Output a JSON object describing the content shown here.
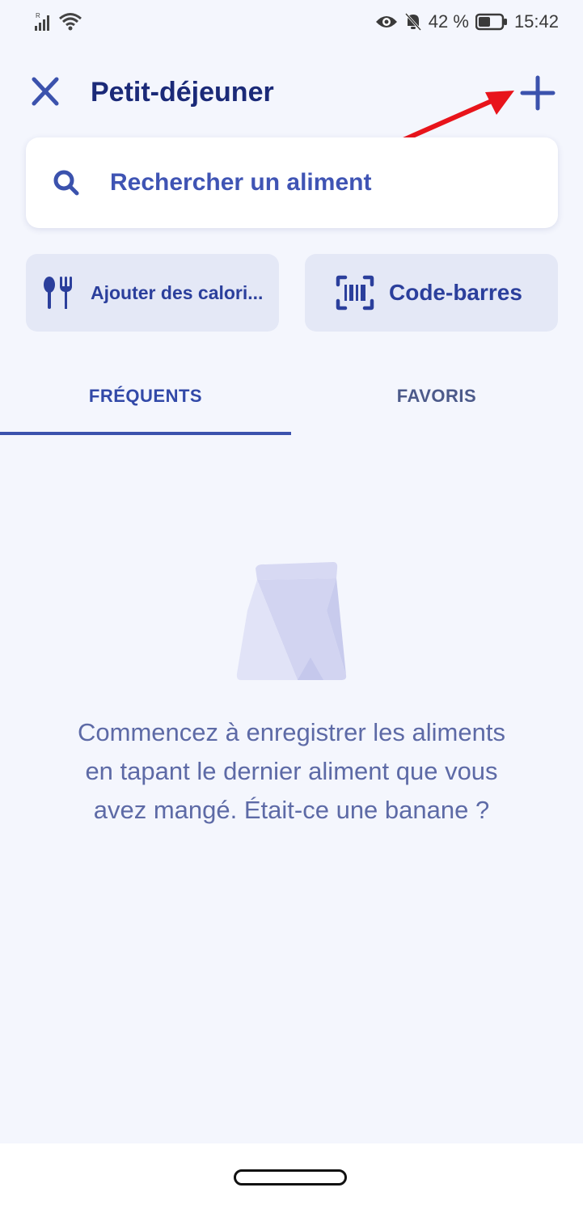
{
  "status_bar": {
    "battery_percent": "42 %",
    "time": "15:42",
    "icons": [
      "signal-icon",
      "wifi-icon",
      "eye-icon",
      "bell-off-icon",
      "battery-icon"
    ]
  },
  "header": {
    "title": "Petit-déjeuner",
    "close_icon": "close-icon",
    "add_icon": "plus-icon"
  },
  "search": {
    "placeholder": "Rechercher un aliment",
    "icon": "search-icon"
  },
  "actions": {
    "calories_label": "Ajouter des calori...",
    "calories_icon": "utensils-icon",
    "barcode_label": "Code-barres",
    "barcode_icon": "barcode-scan-icon"
  },
  "tabs": [
    {
      "label": "FRÉQUENTS",
      "active": true
    },
    {
      "label": "FAVORIS",
      "active": false
    }
  ],
  "empty_state": {
    "icon": "paper-bag-icon",
    "message": "Commencez à enregistrer les aliments en tapant le dernier aliment que vous avez mangé. Était-ce une banane ?"
  },
  "colors": {
    "background": "#f4f6fd",
    "primary": "#3b52ad",
    "title": "#1b2a78",
    "button_bg": "#e4e8f6",
    "annotation_arrow": "#e8141b"
  }
}
